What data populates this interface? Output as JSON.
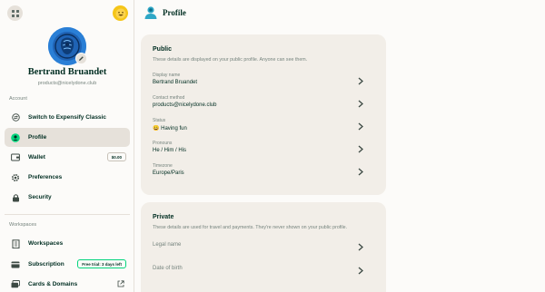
{
  "sidebar": {
    "profile_name": "Bertrand Bruandet",
    "profile_email": "products@nicelydone.club",
    "account_section": "Account",
    "workspaces_section": "Workspaces",
    "account_items": [
      {
        "label": "Switch to Expensify Classic"
      },
      {
        "label": "Profile"
      },
      {
        "label": "Wallet",
        "badge": "$0.00"
      },
      {
        "label": "Preferences"
      },
      {
        "label": "Security"
      }
    ],
    "workspace_items": [
      {
        "label": "Workspaces"
      },
      {
        "label": "Subscription",
        "badge": "Free trial: 3 days left"
      },
      {
        "label": "Cards & Domains"
      }
    ]
  },
  "header": {
    "title": "Profile"
  },
  "public": {
    "title": "Public",
    "subtitle": "These details are displayed on your public profile. Anyone can see them.",
    "fields": [
      {
        "label": "Display name",
        "value": "Bertrand Bruandet"
      },
      {
        "label": "Contact method",
        "value": "products@nicelydone.club"
      },
      {
        "label": "Status",
        "value": "😀 Having fun"
      },
      {
        "label": "Pronouns",
        "value": "He / Him / His"
      },
      {
        "label": "Timezone",
        "value": "Europe/Paris"
      }
    ]
  },
  "private": {
    "title": "Private",
    "subtitle": "These details are used for travel and payments. They're never shown on your public profile.",
    "fields": [
      {
        "label": "Legal name"
      },
      {
        "label": "Date of birth"
      }
    ]
  },
  "colors": {
    "accent": "#03d47c",
    "text": "#002e22",
    "muted": "#76847e",
    "card": "#f2eee8",
    "highlight": "#e6e1da"
  }
}
